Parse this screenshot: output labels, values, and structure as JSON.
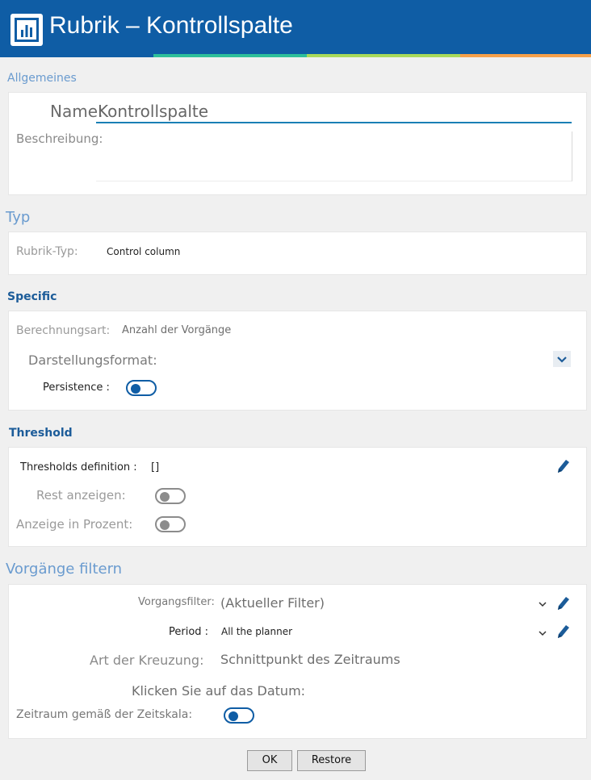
{
  "window": {
    "title": "Rubrik – Kontrollspalte",
    "accent_colors": [
      "#0f5da5",
      "#2ebf9a",
      "#a8d95a",
      "#f5a04a"
    ]
  },
  "general": {
    "section_title": "Allgemeines",
    "name_label": "Name:",
    "name_value": "Kontrollspalte",
    "description_label": "Beschreibung:",
    "description_value": ""
  },
  "type": {
    "section_title": "Typ",
    "rubric_type_label": "Rubrik-Typ:",
    "rubric_type_value": "Control column"
  },
  "specific": {
    "section_title": "Specific",
    "calc_label": "Berechnungsart:",
    "calc_value": "Anzahl der Vorgänge",
    "format_label": "Darstellungsformat:",
    "format_value": "",
    "persistence_label": "Persistence :",
    "persistence_on": true
  },
  "threshold": {
    "section_title": "Threshold",
    "definition_label": "Thresholds definition :",
    "definition_value": "[]",
    "rest_label": "Rest anzeigen:",
    "rest_on": false,
    "percent_label": "Anzeige in Prozent:",
    "percent_on": false
  },
  "filter": {
    "section_title": "Vorgänge filtern",
    "task_filter_label": "Vorgangsfilter:",
    "task_filter_value": "(Aktueller Filter)",
    "period_label": "Period :",
    "period_value": "All the planner",
    "crossing_label": "Art der Kreuzung:",
    "crossing_value": "Schnittpunkt des Zeitraums",
    "click_date_label": "Klicken Sie auf das Datum:",
    "timescale_label": "Zeitraum gemäß der Zeitskala:",
    "timescale_on": true
  },
  "footer": {
    "ok_label": "OK",
    "restore_label": "Restore"
  }
}
